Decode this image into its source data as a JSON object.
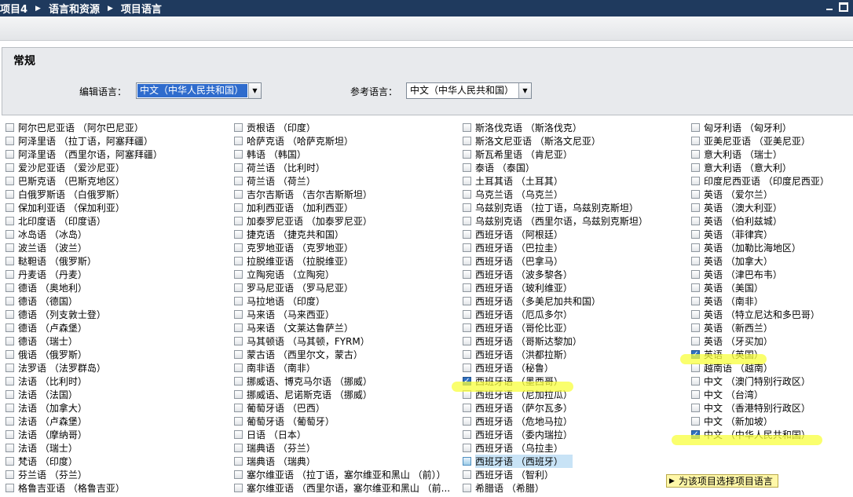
{
  "breadcrumb": [
    "项目4",
    "语言和资源",
    "项目语言"
  ],
  "general": {
    "title": "常规",
    "edit_label": "编辑语言：",
    "edit_value": "中文（中华人民共和国）",
    "ref_label": "参考语言：",
    "ref_value": "中文（中华人民共和国）"
  },
  "columns": [
    [
      {
        "label": "阿尔巴尼亚语 （阿尔巴尼亚）"
      },
      {
        "label": "阿泽里语 （拉丁语，阿塞拜疆）"
      },
      {
        "label": "阿泽里语 （西里尔语，阿塞拜疆）"
      },
      {
        "label": "爱沙尼亚语 （爱沙尼亚）"
      },
      {
        "label": "巴斯克语 （巴斯克地区）"
      },
      {
        "label": "白俄罗斯语 （白俄罗斯）"
      },
      {
        "label": "保加利亚语 （保加利亚）"
      },
      {
        "label": "北印度语 （印度语）"
      },
      {
        "label": "冰岛语 （冰岛）"
      },
      {
        "label": "波兰语 （波兰）"
      },
      {
        "label": "鞑靼语 （俄罗斯）"
      },
      {
        "label": "丹麦语 （丹麦）"
      },
      {
        "label": "德语 （奥地利）"
      },
      {
        "label": "德语 （德国）"
      },
      {
        "label": "德语 （列支敦士登）"
      },
      {
        "label": "德语 （卢森堡）"
      },
      {
        "label": "德语 （瑞士）"
      },
      {
        "label": "俄语 （俄罗斯）"
      },
      {
        "label": "法罗语 （法罗群岛）"
      },
      {
        "label": "法语 （比利时）"
      },
      {
        "label": "法语 （法国）"
      },
      {
        "label": "法语 （加拿大）"
      },
      {
        "label": "法语 （卢森堡）"
      },
      {
        "label": "法语 （摩纳哥）"
      },
      {
        "label": "法语 （瑞士）"
      },
      {
        "label": "梵语 （印度）"
      },
      {
        "label": "芬兰语 （芬兰）"
      },
      {
        "label": "格鲁吉亚语 （格鲁吉亚）"
      }
    ],
    [
      {
        "label": "贡根语 （印度）"
      },
      {
        "label": "哈萨克语 （哈萨克斯坦）"
      },
      {
        "label": "韩语 （韩国）"
      },
      {
        "label": "荷兰语 （比利时）"
      },
      {
        "label": "荷兰语 （荷兰）"
      },
      {
        "label": "吉尔吉斯语 （吉尔吉斯斯坦）"
      },
      {
        "label": "加利西亚语 （加利西亚）"
      },
      {
        "label": "加泰罗尼亚语 （加泰罗尼亚）"
      },
      {
        "label": "捷克语 （捷克共和国）"
      },
      {
        "label": "克罗地亚语 （克罗地亚）"
      },
      {
        "label": "拉脱维亚语 （拉脱维亚）"
      },
      {
        "label": "立陶宛语 （立陶宛）"
      },
      {
        "label": "罗马尼亚语 （罗马尼亚）"
      },
      {
        "label": "马拉地语 （印度）"
      },
      {
        "label": "马来语 （马来西亚）"
      },
      {
        "label": "马来语 （文莱达鲁萨兰）"
      },
      {
        "label": "马其顿语 （马其顿，FYRM）"
      },
      {
        "label": "蒙古语 （西里尔文，蒙古）"
      },
      {
        "label": "南非语 （南非）"
      },
      {
        "label": "挪威语、博克马尔语 （挪威）"
      },
      {
        "label": "挪威语、尼诺斯克语 （挪威）"
      },
      {
        "label": "葡萄牙语 （巴西）"
      },
      {
        "label": "葡萄牙语 （葡萄牙）"
      },
      {
        "label": "日语 （日本）"
      },
      {
        "label": "瑞典语 （芬兰）"
      },
      {
        "label": "瑞典语 （瑞典）"
      },
      {
        "label": "塞尔维亚语 （拉丁语，塞尔维亚和黑山 （前））"
      },
      {
        "label": "塞尔维亚语 （西里尔语，塞尔维亚和黑山 （前..."
      }
    ],
    [
      {
        "label": "斯洛伐克语 （斯洛伐克）"
      },
      {
        "label": "斯洛文尼亚语 （斯洛文尼亚）"
      },
      {
        "label": "斯瓦希里语 （肯尼亚）"
      },
      {
        "label": "泰语 （泰国）"
      },
      {
        "label": "土耳其语 （土耳其）"
      },
      {
        "label": "乌克兰语 （乌克兰）"
      },
      {
        "label": "乌兹别克语 （拉丁语，乌兹别克斯坦）"
      },
      {
        "label": "乌兹别克语 （西里尔语，乌兹别克斯坦）"
      },
      {
        "label": "西班牙语 （阿根廷）"
      },
      {
        "label": "西班牙语 （巴拉圭）"
      },
      {
        "label": "西班牙语 （巴拿马）"
      },
      {
        "label": "西班牙语 （波多黎各）"
      },
      {
        "label": "西班牙语 （玻利维亚）"
      },
      {
        "label": "西班牙语 （多美尼加共和国）"
      },
      {
        "label": "西班牙语 （厄瓜多尔）"
      },
      {
        "label": "西班牙语 （哥伦比亚）"
      },
      {
        "label": "西班牙语 （哥斯达黎加）"
      },
      {
        "label": "西班牙语 （洪都拉斯）"
      },
      {
        "label": "西班牙语 （秘鲁）"
      },
      {
        "label": "西班牙语 （墨西哥）",
        "checked": true
      },
      {
        "label": "西班牙语 （尼加拉瓜）"
      },
      {
        "label": "西班牙语 （萨尔瓦多）"
      },
      {
        "label": "西班牙语 （危地马拉）"
      },
      {
        "label": "西班牙语 （委内瑞拉）"
      },
      {
        "label": "西班牙语 （乌拉圭）"
      },
      {
        "label": "西班牙语 （西班牙）",
        "selected": true
      },
      {
        "label": "西班牙语 （智利）"
      },
      {
        "label": "希腊语 （希腊）"
      }
    ],
    [
      {
        "label": "匈牙利语 （匈牙利）"
      },
      {
        "label": "亚美尼亚语 （亚美尼亚）"
      },
      {
        "label": "意大利语 （瑞士）"
      },
      {
        "label": "意大利语 （意大利）"
      },
      {
        "label": "印度尼西亚语 （印度尼西亚）"
      },
      {
        "label": "英语 （爱尔兰）"
      },
      {
        "label": "英语 （澳大利亚）"
      },
      {
        "label": "英语 （伯利兹城）"
      },
      {
        "label": "英语 （菲律宾）"
      },
      {
        "label": "英语 （加勒比海地区）"
      },
      {
        "label": "英语 （加拿大）"
      },
      {
        "label": "英语 （津巴布韦）"
      },
      {
        "label": "英语 （美国）"
      },
      {
        "label": "英语 （南非）"
      },
      {
        "label": "英语 （特立尼达和多巴哥）"
      },
      {
        "label": "英语 （新西兰）"
      },
      {
        "label": "英语 （牙买加）"
      },
      {
        "label": "英语 （英国）",
        "checked": true
      },
      {
        "label": "越南语 （越南）"
      },
      {
        "label": "中文 （澳门特别行政区）"
      },
      {
        "label": "中文 （台湾）"
      },
      {
        "label": "中文 （香港特别行政区）"
      },
      {
        "label": "中文 （新加坡）"
      },
      {
        "label": "中文 （中华人民共和国）",
        "checked": true
      }
    ]
  ],
  "footer_button": "为该项目选择项目语言",
  "colors": {
    "titlebar": "#1f3a5e",
    "highlight": "#f8ff3c",
    "checkbox_on": "#2f6fbf"
  }
}
